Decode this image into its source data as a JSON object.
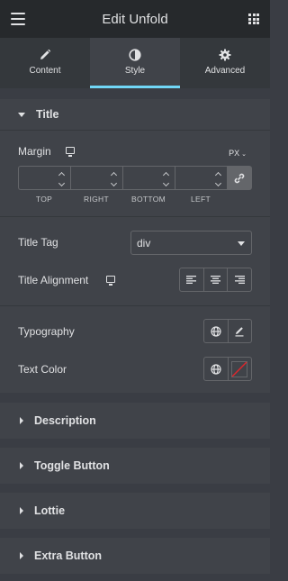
{
  "header": {
    "title": "Edit Unfold",
    "menu_icon": "hamburger-icon",
    "grid_icon": "apps-grid-icon"
  },
  "tabs": [
    {
      "label": "Content",
      "icon": "pencil-icon",
      "active": false
    },
    {
      "label": "Style",
      "icon": "contrast-icon",
      "active": true
    },
    {
      "label": "Advanced",
      "icon": "gear-icon",
      "active": false
    }
  ],
  "section_title": {
    "label": "Title",
    "margin": {
      "label": "Margin",
      "unit": "PX",
      "fields": [
        {
          "label": "TOP",
          "value": ""
        },
        {
          "label": "RIGHT",
          "value": ""
        },
        {
          "label": "BOTTOM",
          "value": ""
        },
        {
          "label": "LEFT",
          "value": ""
        }
      ]
    },
    "title_tag": {
      "label": "Title Tag",
      "value": "div"
    },
    "title_alignment": {
      "label": "Title Alignment"
    },
    "typography": {
      "label": "Typography"
    },
    "text_color": {
      "label": "Text Color"
    }
  },
  "collapsed_sections": [
    "Description",
    "Toggle Button",
    "Lottie",
    "Extra Button"
  ],
  "colors": {
    "accent": "#71d7f7",
    "panel": "#404349",
    "header": "#26292c",
    "clear_red": "#e0262c"
  }
}
